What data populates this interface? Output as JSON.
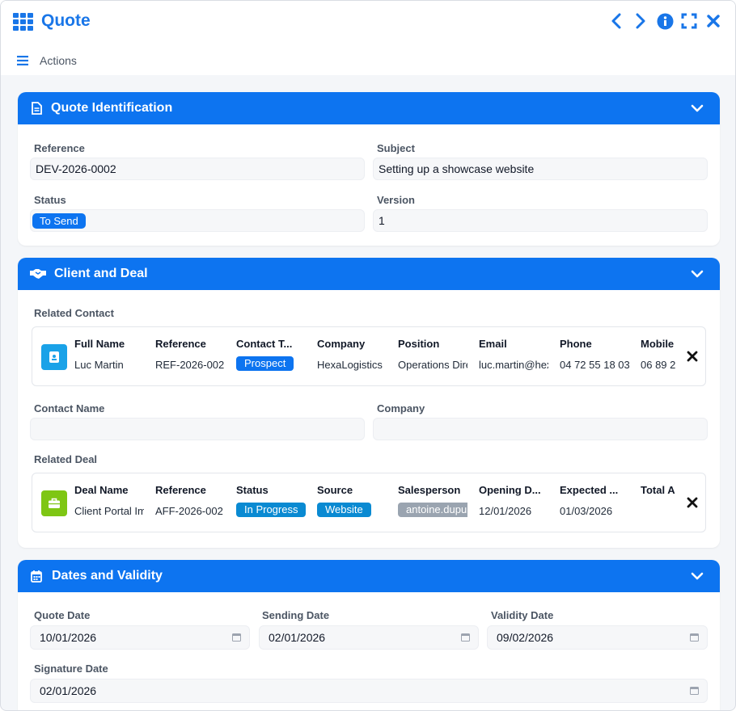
{
  "window": {
    "title": "Quote"
  },
  "icons": {
    "app": "grid-icon",
    "prev": "chevron-left-icon",
    "next": "chevron-right-icon",
    "info": "info-icon",
    "fullscreen": "expand-icon",
    "close": "close-icon",
    "menu": "hamburger-icon",
    "quote_section": "document-icon",
    "client_section": "handshake-icon",
    "dates_section": "calendar-icon",
    "contact": "id-card-icon",
    "deal": "briefcase-icon"
  },
  "colors": {
    "accent": "#0d74f0",
    "title": "#1976e8",
    "contact_icon": "#1aa2e8",
    "deal_icon": "#7ec614"
  },
  "actions": {
    "label": "Actions"
  },
  "sections": {
    "identification": {
      "title": "Quote Identification",
      "reference_label": "Reference",
      "reference_value": "DEV-2026-0002",
      "subject_label": "Subject",
      "subject_value": "Setting up a showcase website",
      "status_label": "Status",
      "status_value": "To Send",
      "version_label": "Version",
      "version_value": "1"
    },
    "client": {
      "title": "Client and Deal",
      "related_contact_label": "Related Contact",
      "contact": {
        "headers": [
          "Full Name",
          "Reference",
          "Contact T...",
          "Company",
          "Position",
          "Email",
          "Phone",
          "Mobile"
        ],
        "values": [
          "Luc Martin",
          "REF-2026-002",
          "Prospect",
          "HexaLogistics",
          "Operations Director",
          "luc.martin@hexalogistics.com",
          "04 72 55 18 03",
          "06 89 2"
        ]
      },
      "contact_name_label": "Contact Name",
      "contact_name_value": "",
      "company_label": "Company",
      "company_value": "",
      "related_deal_label": "Related Deal",
      "deal": {
        "headers": [
          "Deal Name",
          "Reference",
          "Status",
          "Source",
          "Salesperson",
          "Opening D...",
          "Expected ...",
          "Total A"
        ],
        "values": [
          "Client Portal Implementation",
          "AFF-2026-002",
          "In Progress",
          "Website",
          "antoine.dupuis",
          "12/01/2026",
          "01/03/2026",
          ""
        ]
      }
    },
    "dates": {
      "title": "Dates and Validity",
      "quote_date_label": "Quote Date",
      "quote_date_value": "10/01/2026",
      "sending_date_label": "Sending Date",
      "sending_date_value": "02/01/2026",
      "validity_date_label": "Validity Date",
      "validity_date_value": "09/02/2026",
      "signature_date_label": "Signature Date",
      "signature_date_value": "02/01/2026"
    }
  }
}
